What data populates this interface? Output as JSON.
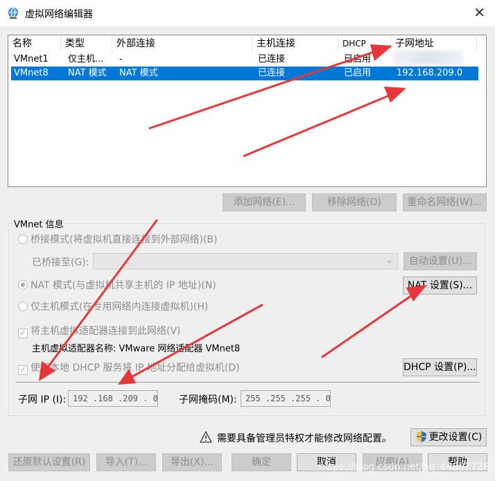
{
  "window": {
    "title": "虚拟网络编辑器",
    "close_label": "✕"
  },
  "list": {
    "columns": [
      "名称",
      "类型",
      "外部连接",
      "主机连接",
      "DHCP",
      "子网地址"
    ],
    "rows": [
      {
        "name": "VMnet1",
        "type": "仅主机...",
        "external": "-",
        "host": "已连接",
        "dhcp": "已启用",
        "subnet": ""
      },
      {
        "name": "VMnet8",
        "type": "NAT 模式",
        "external": "NAT 模式",
        "host": "已连接",
        "dhcp": "已启用",
        "subnet": "192.168.209.0"
      }
    ]
  },
  "list_buttons": {
    "add": "添加网络(E)...",
    "remove": "移除网络(O)",
    "rename": "重命名网络(W)..."
  },
  "vmnet_info": {
    "group_label": "VMnet 信息",
    "bridge_mode": "桥接模式(将虚拟机直接连接到外部网络)(B)",
    "bridged_to_label": "已桥接至(G):",
    "auto_settings": "自动设置(U)...",
    "nat_mode": "NAT 模式(与虚拟机共享主机的 IP 地址)(N)",
    "nat_settings": "NAT 设置(S)...",
    "host_only_mode": "仅主机模式(在专用网络内连接虚拟机)(H)",
    "connect_adapter": "将主机虚拟适配器连接到此网络(V)",
    "adapter_name": "主机虚拟适配器名称: VMware 网络适配器 VMnet8",
    "use_dhcp": "使用本地 DHCP 服务将 IP 地址分配给虚拟机(D)",
    "dhcp_settings": "DHCP 设置(P)...",
    "subnet_ip_label": "子网 IP (I):",
    "subnet_ip_value": "192 .168 .209 . 0",
    "subnet_mask_label": "子网掩码(M):",
    "subnet_mask_value": "255 .255 .255 . 0"
  },
  "admin": {
    "warning": "需要具备管理员特权才能修改网络配置。",
    "change_settings": "更改设置(C)"
  },
  "bottom_buttons": {
    "restore": "还原默认设置(R)",
    "import": "导入(T)...",
    "export": "导出(X)...",
    "ok": "确定",
    "cancel": "取消",
    "apply": "应用(A)",
    "help": "帮助"
  },
  "watermark": "https://blog.csdn.net/qq_44887728",
  "colors": {
    "selection": "#0078d7",
    "arrow": "#e8373a"
  }
}
